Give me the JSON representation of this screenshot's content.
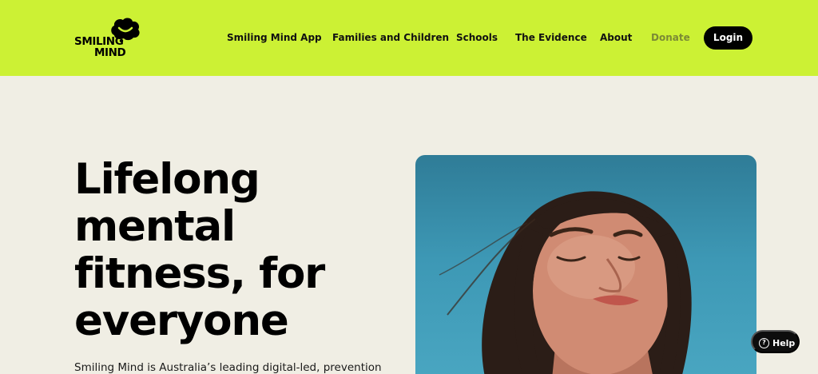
{
  "header": {
    "logo": {
      "line1": "SMILING",
      "line2": "MIND"
    },
    "nav": [
      {
        "label": "Smiling Mind App"
      },
      {
        "label": "Families and Children"
      },
      {
        "label": "Schools"
      },
      {
        "label": "The Evidence"
      },
      {
        "label": "About"
      },
      {
        "label": "Donate"
      }
    ],
    "login_label": "Login"
  },
  "hero": {
    "title_lines": [
      "Lifelong",
      "mental",
      "fitness, for",
      "everyone"
    ],
    "description": "Smiling Mind is Australia’s leading digital-led, prevention"
  },
  "help": {
    "icon": "?",
    "label": "Help"
  },
  "colors": {
    "header_bg": "#ccf134",
    "page_bg": "#f0eee4",
    "button_bg": "#000000",
    "muted_nav": "#7b8a35"
  },
  "icons": [
    "brain-logo-icon",
    "help-circle-icon"
  ]
}
